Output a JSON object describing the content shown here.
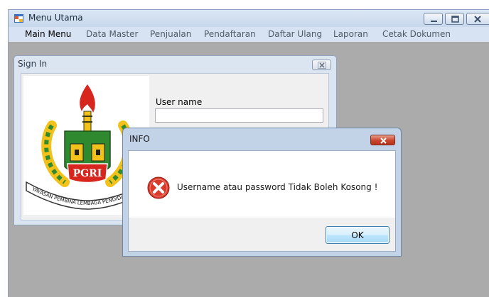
{
  "main_window": {
    "title": "Menu Utama",
    "menu": [
      "Main Menu",
      "Data Master",
      "Penjualan",
      "Pendaftaran",
      "Daftar Ulang",
      "Laporan",
      "Cetak Dokumen"
    ]
  },
  "signin_window": {
    "title": "Sign In",
    "logo_text": {
      "acronym": "PGRI",
      "arc": "YAYASAN PEMBINA LEMBAGA PENDIDIKAN"
    },
    "username_label": "User name",
    "username_value": ""
  },
  "info_dialog": {
    "title": "INFO",
    "message": "Username atau password Tidak Boleh Kosong !",
    "ok_label": "OK"
  },
  "colors": {
    "error_red": "#d93b2b",
    "close_button_red": "#c9452c",
    "mdi_background": "#ababab"
  }
}
